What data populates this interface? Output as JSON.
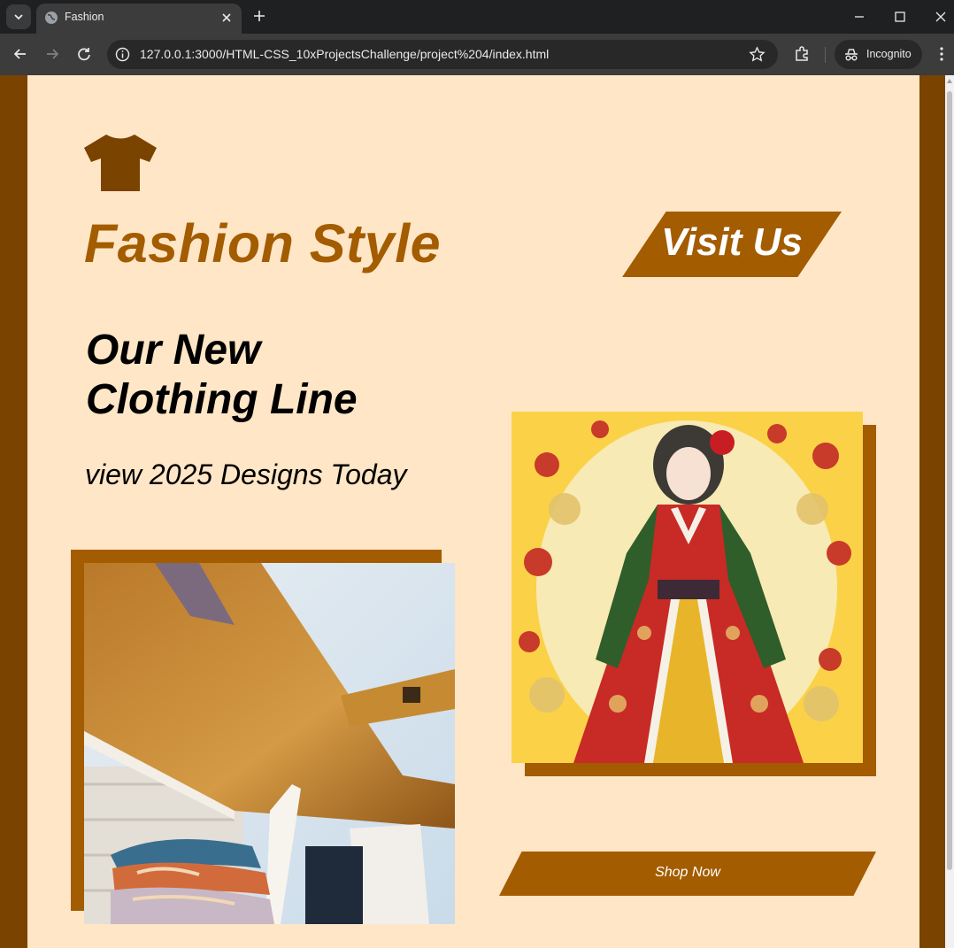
{
  "browser": {
    "tab_title": "Fashion",
    "url": "127.0.0.1:3000/HTML-CSS_10xProjectsChallenge/project%204/index.html",
    "profile_label": "Incognito"
  },
  "page": {
    "brand_title": "Fashion Style",
    "visit_button_label": "Visit Us",
    "headline_line1": "Our New",
    "headline_line2": "Clothing Line",
    "subheading": "view 2025 Designs Today",
    "shop_button_label": "Shop Now",
    "colors": {
      "background": "#fee6c6",
      "accent": "#a35c00",
      "outer": "#7a4300"
    },
    "icons": {
      "logo": "tshirt-icon"
    }
  }
}
